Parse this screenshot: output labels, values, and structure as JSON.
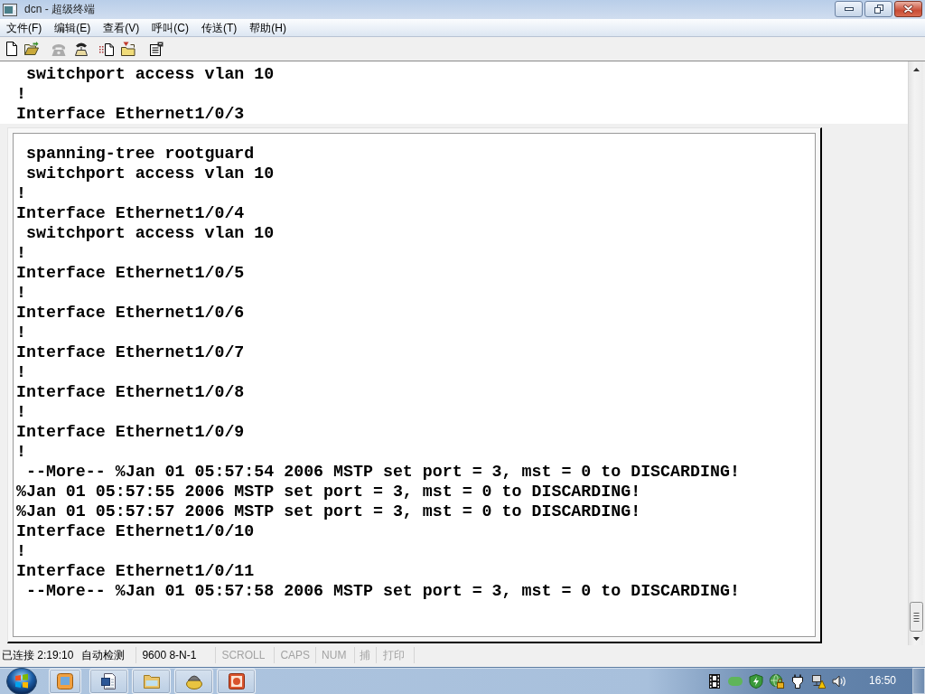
{
  "window": {
    "title": "dcn - 超级终端"
  },
  "menu": [
    "文件(F)",
    "编辑(E)",
    "查看(V)",
    "呼叫(C)",
    "传送(T)",
    "帮助(H)"
  ],
  "toolbar": [
    {
      "disabled": false
    },
    {
      "disabled": false
    },
    {
      "disabled": true
    },
    {
      "disabled": false
    },
    {
      "disabled": false
    },
    {
      "disabled": false
    },
    {
      "disabled": false
    }
  ],
  "terminal": {
    "lines": [
      " switchport access vlan 10",
      "!",
      "Interface Ethernet1/0/3"
    ],
    "panel": {
      "lines": [
        " spanning-tree rootguard",
        " switchport access vlan 10",
        "!",
        "Interface Ethernet1/0/4",
        " switchport access vlan 10",
        "!",
        "Interface Ethernet1/0/5",
        "!",
        "Interface Ethernet1/0/6",
        "!",
        "Interface Ethernet1/0/7",
        "!",
        "Interface Ethernet1/0/8",
        "!",
        "Interface Ethernet1/0/9",
        "!",
        " --More-- %Jan 01 05:57:54 2006 MSTP set port = 3, mst = 0 to DISCARDING!",
        "%Jan 01 05:57:55 2006 MSTP set port = 3, mst = 0 to DISCARDING!",
        "%Jan 01 05:57:57 2006 MSTP set port = 3, mst = 0 to DISCARDING!",
        "Interface Ethernet1/0/10",
        "!",
        "Interface Ethernet1/0/11",
        " --More-- %Jan 01 05:57:58 2006 MSTP set port = 3, mst = 0 to DISCARDING!"
      ]
    }
  },
  "status_bar": [
    {
      "text": "已连接 2:19:10",
      "disabled": false
    },
    {
      "text": "自动检测",
      "disabled": false
    },
    {
      "text": "9600 8-N-1",
      "disabled": false
    },
    {
      "text": "SCROLL",
      "disabled": true
    },
    {
      "text": "CAPS",
      "disabled": true
    },
    {
      "text": "NUM",
      "disabled": true
    },
    {
      "text": "捕",
      "disabled": true
    },
    {
      "text": "打印",
      "disabled": true
    }
  ],
  "taskbar": {
    "clock": "16:50"
  }
}
